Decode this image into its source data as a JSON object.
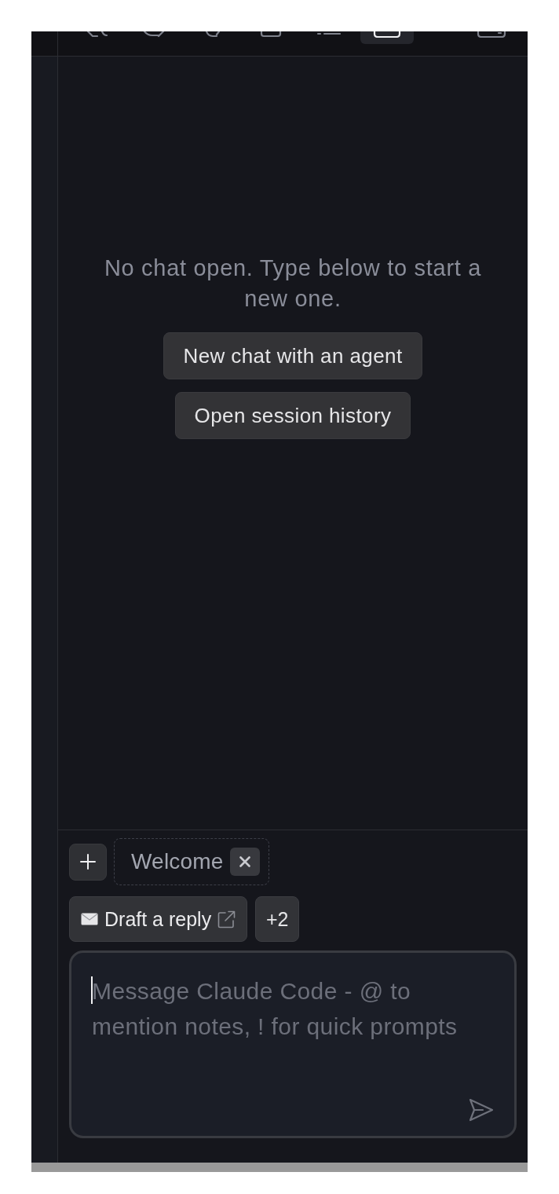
{
  "toolbar": {
    "buttons": [
      {
        "selected": false
      },
      {
        "selected": false
      },
      {
        "selected": false
      },
      {
        "selected": false
      },
      {
        "selected": false
      },
      {
        "selected": true
      },
      {
        "selected": false
      }
    ]
  },
  "empty_state": {
    "message": "No chat open. Type below to start a new one.",
    "actions": [
      "New chat with an agent",
      "Open session history"
    ]
  },
  "composer": {
    "context_chips": [
      {
        "label": "Welcome"
      }
    ],
    "quick_prompts": [
      {
        "label": "Draft a reply"
      }
    ],
    "more_prompts": "+2",
    "input": {
      "placeholder": "Message Claude Code - @ to mention notes, ! for quick prompts",
      "focused": true
    }
  }
}
